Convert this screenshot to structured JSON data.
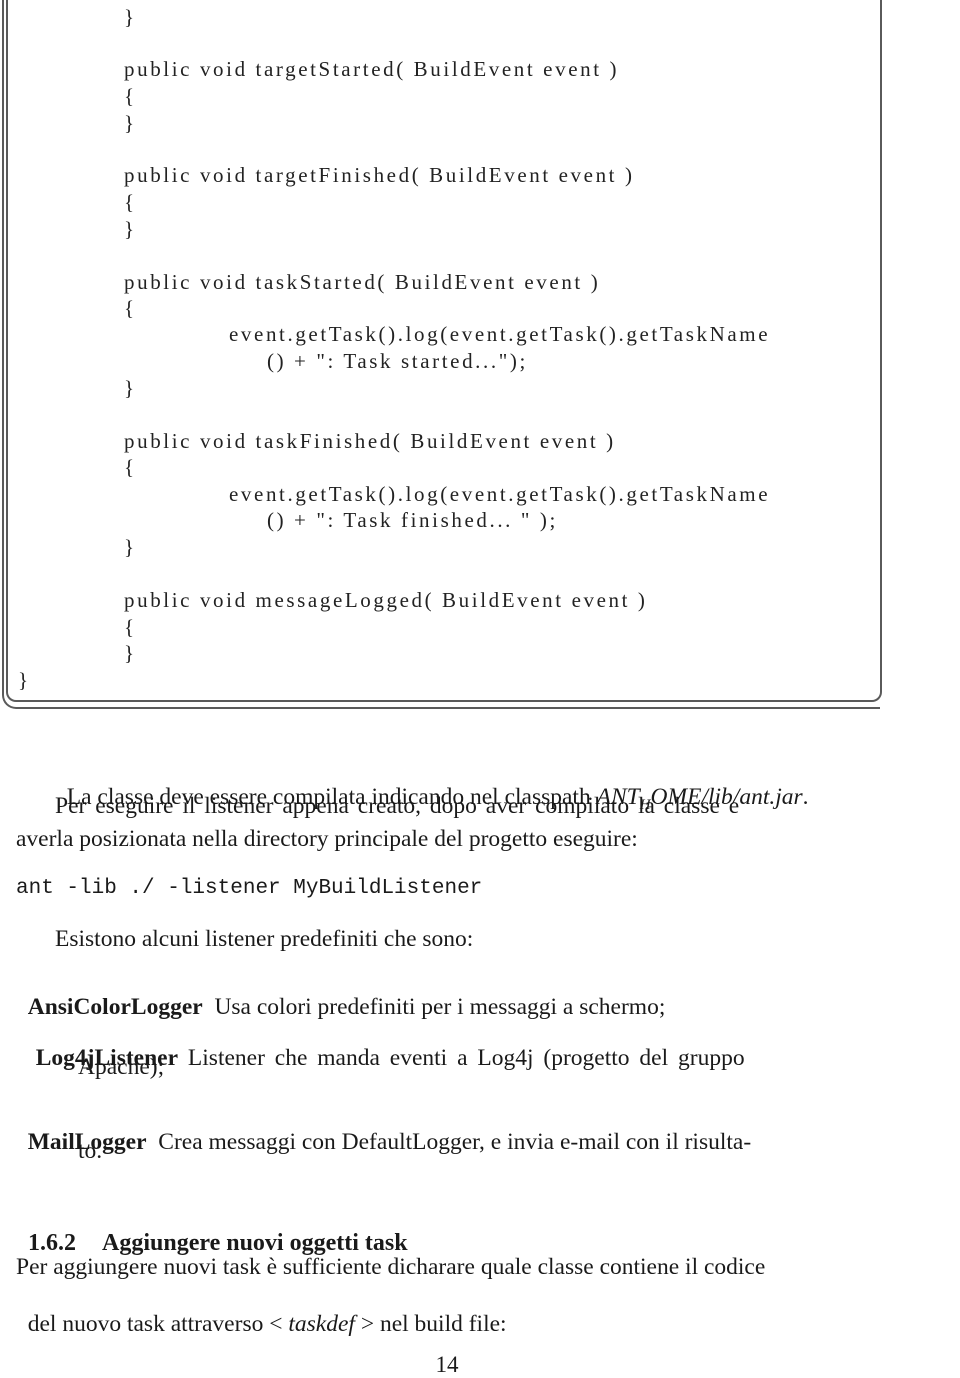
{
  "code_block": {
    "lines": [
      "}",
      "public void targetStarted( BuildEvent event )",
      "{",
      "}",
      "public void targetFinished( BuildEvent event )",
      "{",
      "}",
      "public void taskStarted( BuildEvent event )",
      "{",
      "event.getTask().log(event.getTask().getTaskName",
      "() + \": Task started...\");",
      "}",
      "public void taskFinished( BuildEvent event )",
      "{",
      "event.getTask().log(event.getTask().getTaskName",
      "() + \": Task finished... \" );",
      "}",
      "public void messageLogged( BuildEvent event )",
      "{",
      "}",
      "}"
    ]
  },
  "paragraphs": {
    "compile_note": {
      "prefix": "La classe deve essere compilata indicando nel classpath ",
      "math_ant": "ANT",
      "math_sub": "H",
      "math_rest": "OME/lib/ant.jar",
      "suffix": "."
    },
    "run_intro_line1": "Per eseguire il listener appena creato, dopo aver compilato la classe e",
    "run_intro_line2": "averla posizionata nella directory principale del progetto eseguire:",
    "command": "ant -lib ./ -listener MyBuildListener",
    "listeners_intro": "Esistono alcuni listener predefiniti che sono:"
  },
  "listeners": [
    {
      "term": "AnsiColorLogger",
      "description_line1": "Usa colori predefiniti per i messaggi a schermo;",
      "description_line2": ""
    },
    {
      "term": "Log4jListener",
      "description_line1": "Listener che manda eventi a Log4j (progetto del gruppo",
      "description_line2": "Apache);"
    },
    {
      "term": "MailLogger",
      "description_line1": "Crea messaggi con DefaultLogger, e invia e-mail con il risulta-",
      "description_line2": "to."
    }
  ],
  "section": {
    "number": "1.6.2",
    "title": "Aggiungere nuovi oggetti task",
    "body_line1": "Per aggiungere nuovi task è sufficiente dicharare quale classe contiene il codice",
    "body_line2_prefix": "del nuovo task attraverso ",
    "body_line2_lt": "<",
    "body_line2_math": "taskdef",
    "body_line2_gt": ">",
    "body_line2_suffix": " nel build file:"
  },
  "page_number": "14"
}
